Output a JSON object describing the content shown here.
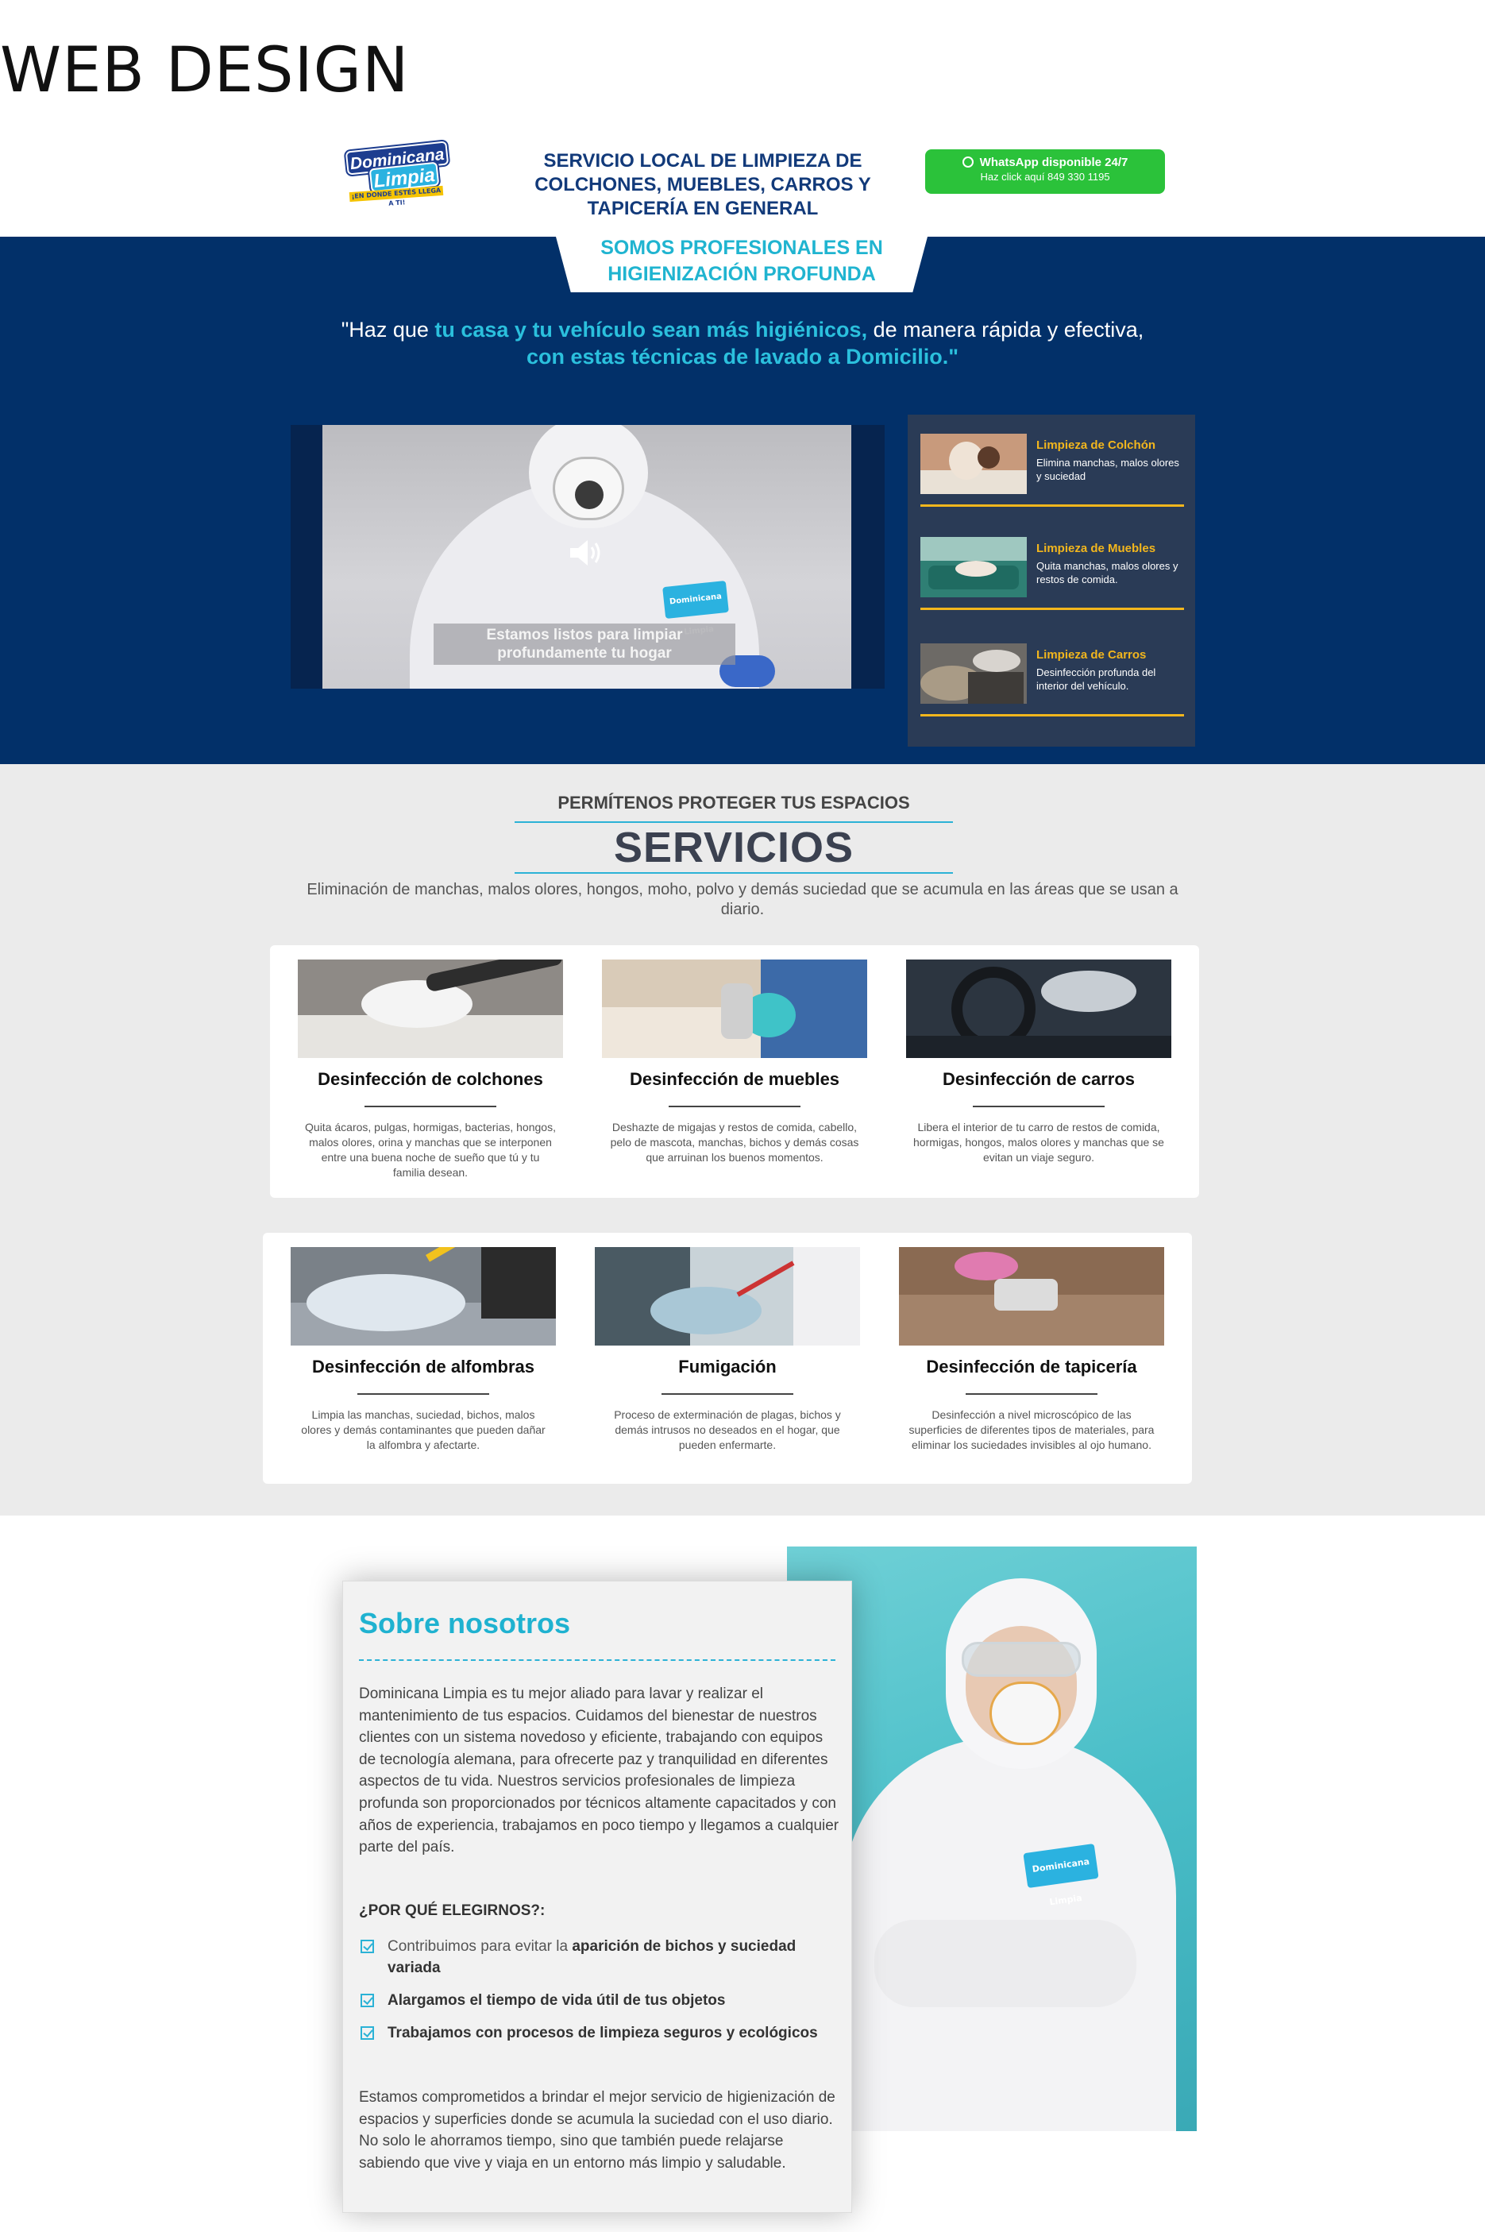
{
  "page_heading": "WEB DESIGN",
  "header": {
    "logo": {
      "line1": "Dominicana",
      "line2": "Limpia",
      "tagline": "¡EN DONDE ESTÉS LLEGA A TI!"
    },
    "title": "SERVICIO LOCAL DE LIMPIEZA DE COLCHONES, MUEBLES, CARROS Y TAPICERÍA EN GENERAL",
    "whatsapp": {
      "label": "WhatsApp disponible 24/7",
      "sub": "Haz click aquí 849 330 1195",
      "icon": "whatsapp-icon"
    }
  },
  "hero": {
    "tab_text": "SOMOS PROFESIONALES EN HIGIENIZACIÓN PROFUNDA",
    "quote": {
      "part1": "\"Haz que ",
      "hl1": "tu casa y tu vehículo sean más higiénicos,",
      "part2": " de manera rápida y efectiva,",
      "hl2": "con estas técnicas de lavado a Domicilio.\""
    },
    "video": {
      "caption": "Estamos listos para limpiar profundamente tu hogar",
      "chest_logo": "Dominicana Limpia",
      "icon": "speaker-icon"
    },
    "services_panel": [
      {
        "title": "Limpieza de Colchón",
        "desc": "Elimina manchas, malos olores y suciedad"
      },
      {
        "title": "Limpieza de Muebles",
        "desc": "Quita manchas, malos olores y restos de comida."
      },
      {
        "title": "Limpieza de Carros",
        "desc": "Desinfección profunda del interior del vehículo."
      }
    ]
  },
  "services": {
    "kicker": "PERMÍTENOS PROTEGER TUS ESPACIOS",
    "title": "SERVICIOS",
    "subtitle": "Eliminación de manchas, malos olores, hongos, moho, polvo y demás suciedad que se acumula en las áreas que se usan a diario.",
    "cards": [
      {
        "title": "Desinfección de colchones",
        "desc": "Quita ácaros, pulgas, hormigas, bacterias, hongos, malos olores, orina y manchas que se interponen entre una buena noche de sueño que tú y tu familia desean."
      },
      {
        "title": "Desinfección de muebles",
        "desc": "Deshazte de migajas y restos de comida, cabello, pelo de mascota, manchas, bichos y demás cosas que arruinan los buenos momentos."
      },
      {
        "title": "Desinfección de carros",
        "desc": "Libera el interior de tu carro de restos de comida, hormigas, hongos, malos olores y manchas que se evitan un viaje seguro."
      },
      {
        "title": "Desinfección de alfombras",
        "desc": "Limpia las manchas, suciedad, bichos, malos olores y demás contaminantes que pueden dañar la alfombra y afectarte."
      },
      {
        "title": "Fumigación",
        "desc": "Proceso de exterminación de plagas, bichos y demás intrusos no deseados en el hogar, que pueden enfermarte."
      },
      {
        "title": "Desinfección de tapicería",
        "desc": "Desinfección a nivel microscópico de las superficies de diferentes tipos de materiales, para eliminar los suciedades invisibles al ojo humano."
      }
    ]
  },
  "about": {
    "title": "Sobre nosotros",
    "p1": "Dominicana Limpia es tu mejor aliado para lavar y realizar el mantenimiento de tus espacios. Cuidamos del bienestar de nuestros clientes con un sistema novedoso y eficiente, trabajando con equipos de tecnología alemana, para ofrecerte paz y tranquilidad en diferentes aspectos de tu vida. Nuestros servicios profesionales de limpieza profunda son proporcionados por técnicos altamente capacitados y con años de experiencia, trabajamos en poco tiempo y llegamos a cualquier parte del país.",
    "why": "¿POR QUÉ ELEGIRNOS?:",
    "reasons": [
      {
        "pre": "Contribuimos para evitar la ",
        "bold": "aparición de bichos y suciedad variada"
      },
      {
        "pre": "",
        "bold": "Alargamos el tiempo de vida útil de tus objetos"
      },
      {
        "pre": "",
        "bold": "Trabajamos con procesos de limpieza seguros y ecológicos"
      }
    ],
    "p2": "Estamos comprometidos a brindar el mejor servicio de higienización de espacios y superficies donde se acumula la suciedad con el uso diario. No solo le ahorramos tiempo, sino que también puede relajarse sabiendo que vive y viaja en un entorno más limpio y saludable.",
    "photo_badge": "Dominicana Limpia"
  },
  "colors": {
    "navy": "#023069",
    "accent": "#2bb2d6",
    "gold": "#f2b61d",
    "whatsapp": "#2bc23a"
  }
}
